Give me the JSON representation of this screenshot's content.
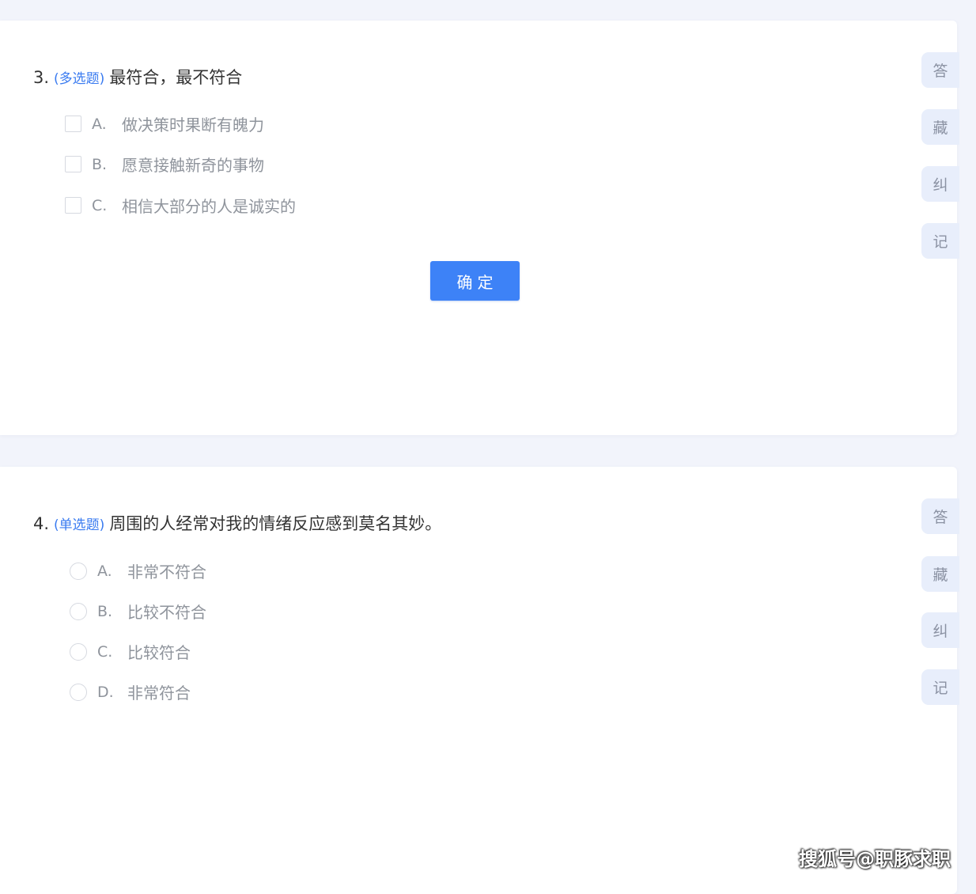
{
  "questions": [
    {
      "number": "3.",
      "type": "(多选题)",
      "text": "最符合，最不符合",
      "options": [
        {
          "letter": "A.",
          "text": "做决策时果断有魄力"
        },
        {
          "letter": "B.",
          "text": "愿意接触新奇的事物"
        },
        {
          "letter": "C.",
          "text": "相信大部分的人是诚实的"
        }
      ],
      "confirm_label": "确定",
      "tools": [
        "答",
        "藏",
        "纠",
        "记"
      ]
    },
    {
      "number": "4.",
      "type": "(单选题)",
      "text": "周围的人经常对我的情绪反应感到莫名其妙。",
      "options": [
        {
          "letter": "A.",
          "text": "非常不符合"
        },
        {
          "letter": "B.",
          "text": "比较不符合"
        },
        {
          "letter": "C.",
          "text": "比较符合"
        },
        {
          "letter": "D.",
          "text": "非常符合"
        }
      ],
      "tools": [
        "答",
        "藏",
        "纠",
        "记"
      ]
    }
  ],
  "watermark": "搜狐号@职豚求职",
  "colors": {
    "accent": "#3d82f7",
    "type_tag": "#3a7bf0",
    "option_text": "#8f949c",
    "tool_bg": "#e8eefb",
    "page_bg": "#f2f4fb"
  }
}
